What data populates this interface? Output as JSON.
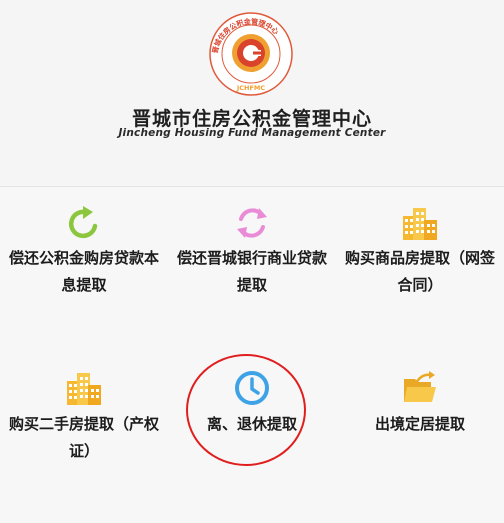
{
  "org": {
    "name_cn": "晋城市住房公积金管理中心",
    "name_en": "Jincheng Housing Fund Management Center",
    "logo_ring_text": "晋城住房公积金管理中心",
    "logo_abbr": "JCHFMC",
    "logo_icon": "coin-logo"
  },
  "colors": {
    "logo_red": "#d9432c",
    "logo_orange": "#f0a030",
    "green": "#8cc63f",
    "pink": "#e98bd6",
    "amber": "#f5b830",
    "blue": "#3ea3e6",
    "annotation_red": "#e01e1e"
  },
  "services": [
    {
      "label": "偿还公积金购房贷款本息提取",
      "icon": "refresh-icon"
    },
    {
      "label": "偿还晋城银行商业贷款提取",
      "icon": "sync-icon"
    },
    {
      "label": "购买商品房提取（网签合同）",
      "icon": "buildings-icon"
    },
    {
      "label": "购买二手房提取（产权证）",
      "icon": "buildings-icon"
    },
    {
      "label": "离、退休提取",
      "icon": "clock-icon"
    },
    {
      "label": "出境定居提取",
      "icon": "folder-icon"
    }
  ]
}
